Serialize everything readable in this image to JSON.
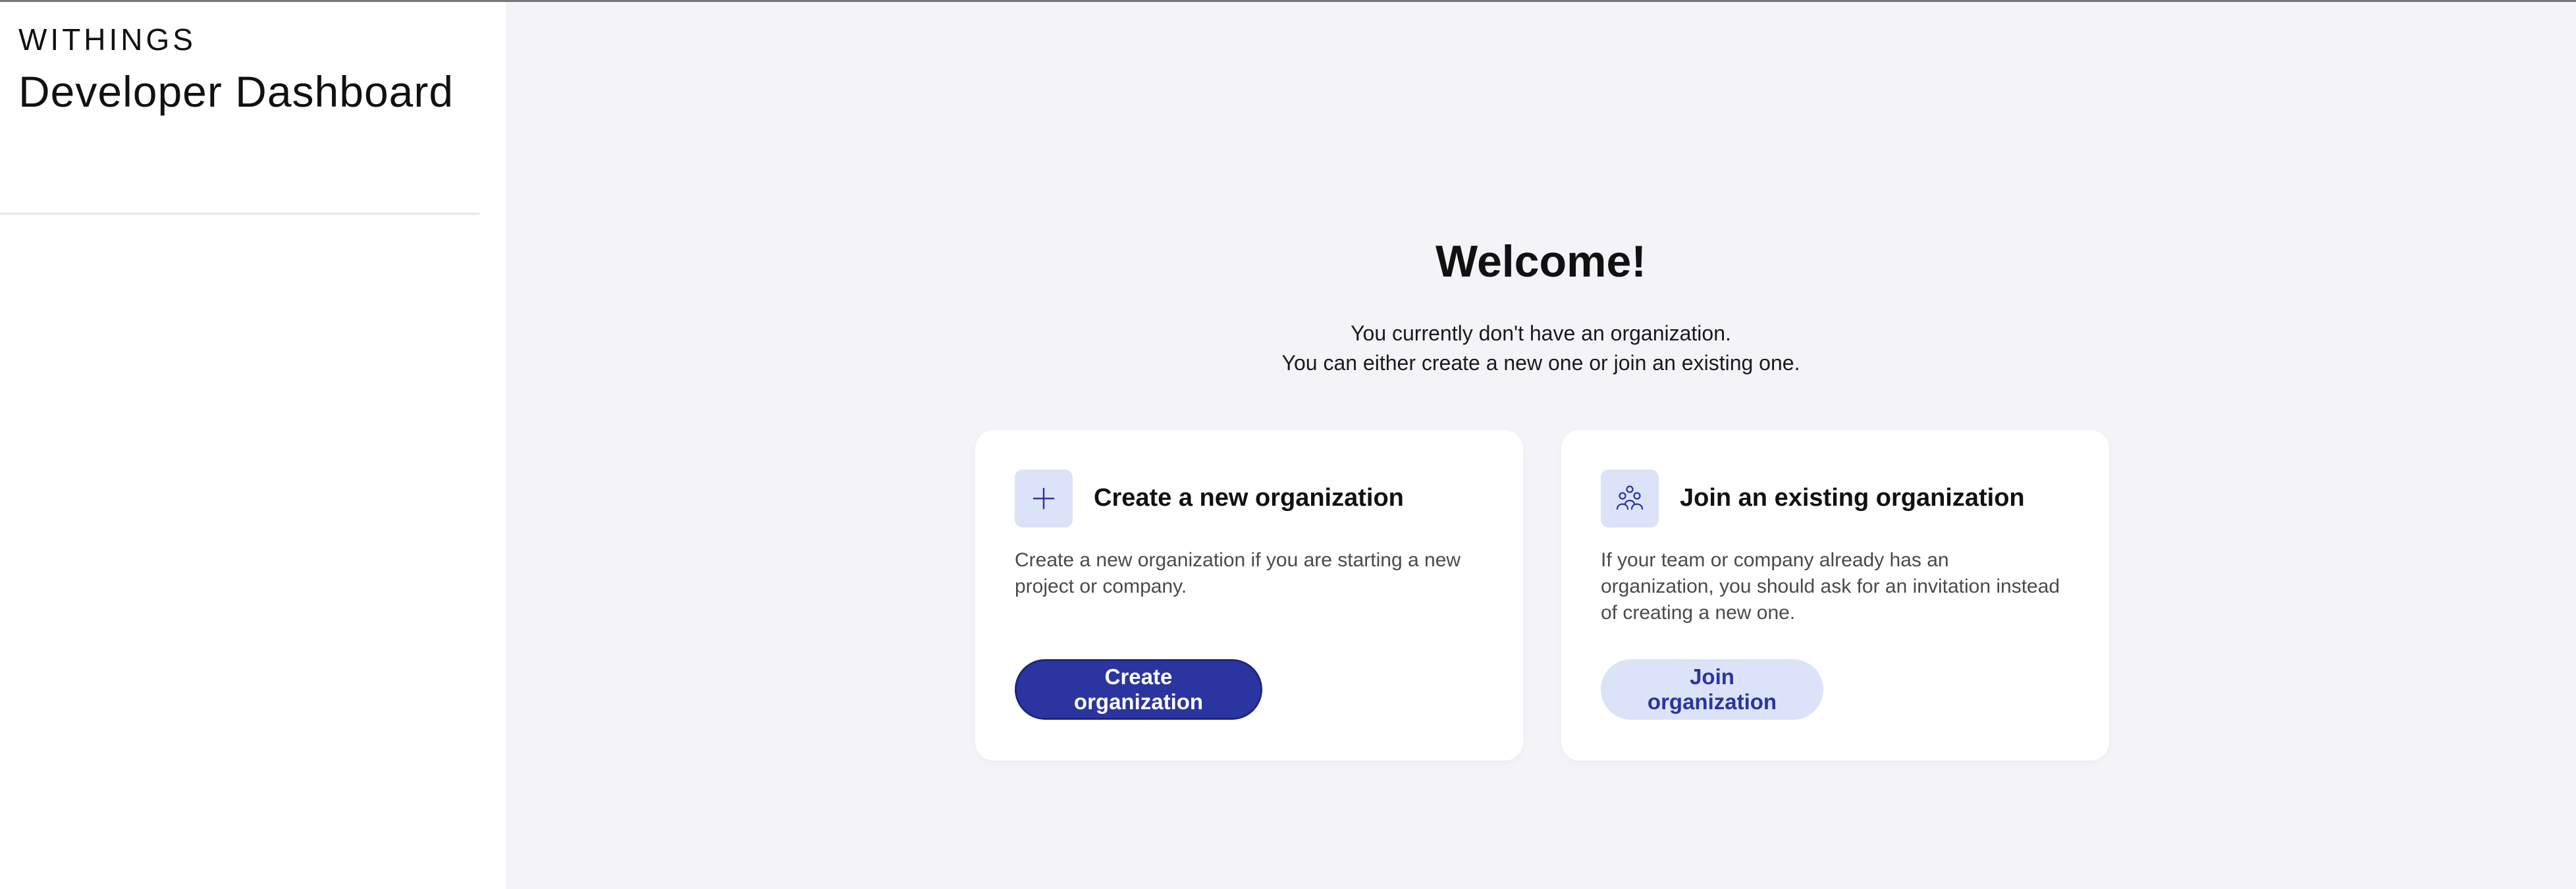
{
  "sidebar": {
    "brand": "WITHINGS",
    "title": "Developer Dashboard"
  },
  "main": {
    "welcome": "Welcome!",
    "subtitle_line1": "You currently don't have an organization.",
    "subtitle_line2": "You can either create a new one or join an existing one."
  },
  "cards": {
    "create": {
      "icon": "plus-icon",
      "title": "Create a new organization",
      "description": "Create a new organization if you are starting a new project or company.",
      "button_label": "Create organization"
    },
    "join": {
      "icon": "team-icon",
      "title": "Join an existing organization",
      "description": "If your team or company already has an organization, you should ask for an invitation instead of creating a new one.",
      "button_label": "Join organization"
    }
  },
  "colors": {
    "accent": "#2a35a0",
    "accent_light": "#dce3f8",
    "background": "#f4f4f8",
    "sidebar_background": "#ffffff"
  }
}
